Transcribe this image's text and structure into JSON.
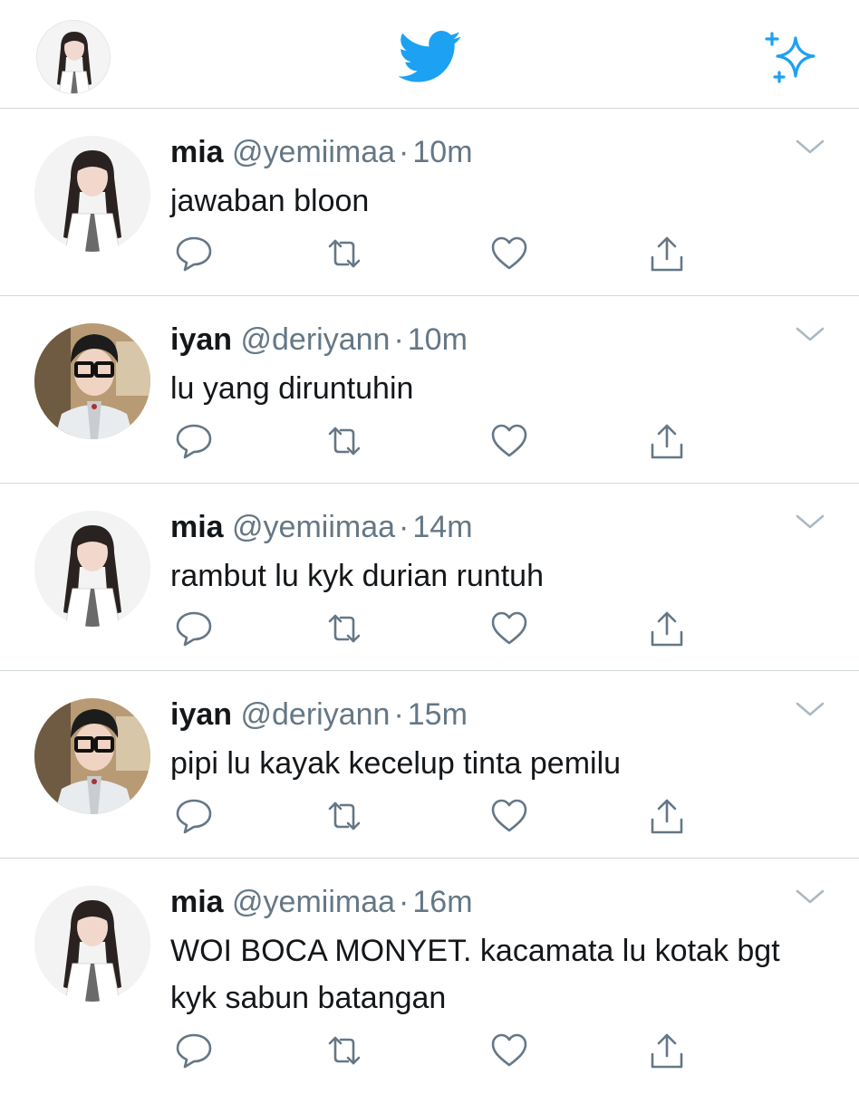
{
  "app": {
    "accent_color": "#1da1f2",
    "icons": {
      "logo": "twitter-bird-icon",
      "sparkle": "top-tweets-sparkle-icon",
      "reply": "reply-icon",
      "retweet": "retweet-icon",
      "like": "like-icon",
      "share": "share-icon",
      "more": "chevron-down-icon"
    }
  },
  "tweets": [
    {
      "name": "mia",
      "handle": "@yemiimaa",
      "sep": "·",
      "time": "10m",
      "text": "jawaban bloon"
    },
    {
      "name": "iyan",
      "handle": "@deriyann",
      "sep": "·",
      "time": "10m",
      "text": "lu yang diruntuhin"
    },
    {
      "name": "mia",
      "handle": "@yemiimaa",
      "sep": "·",
      "time": "14m",
      "text": "rambut lu kyk durian runtuh"
    },
    {
      "name": "iyan",
      "handle": "@deriyann",
      "sep": "·",
      "time": "15m",
      "text": "pipi lu kayak kecelup tinta pemilu"
    },
    {
      "name": "mia",
      "handle": "@yemiimaa",
      "sep": "·",
      "time": "16m",
      "text": "WOI BOCA MONYET. kacamata lu kotak bgt kyk sabun batangan"
    }
  ]
}
